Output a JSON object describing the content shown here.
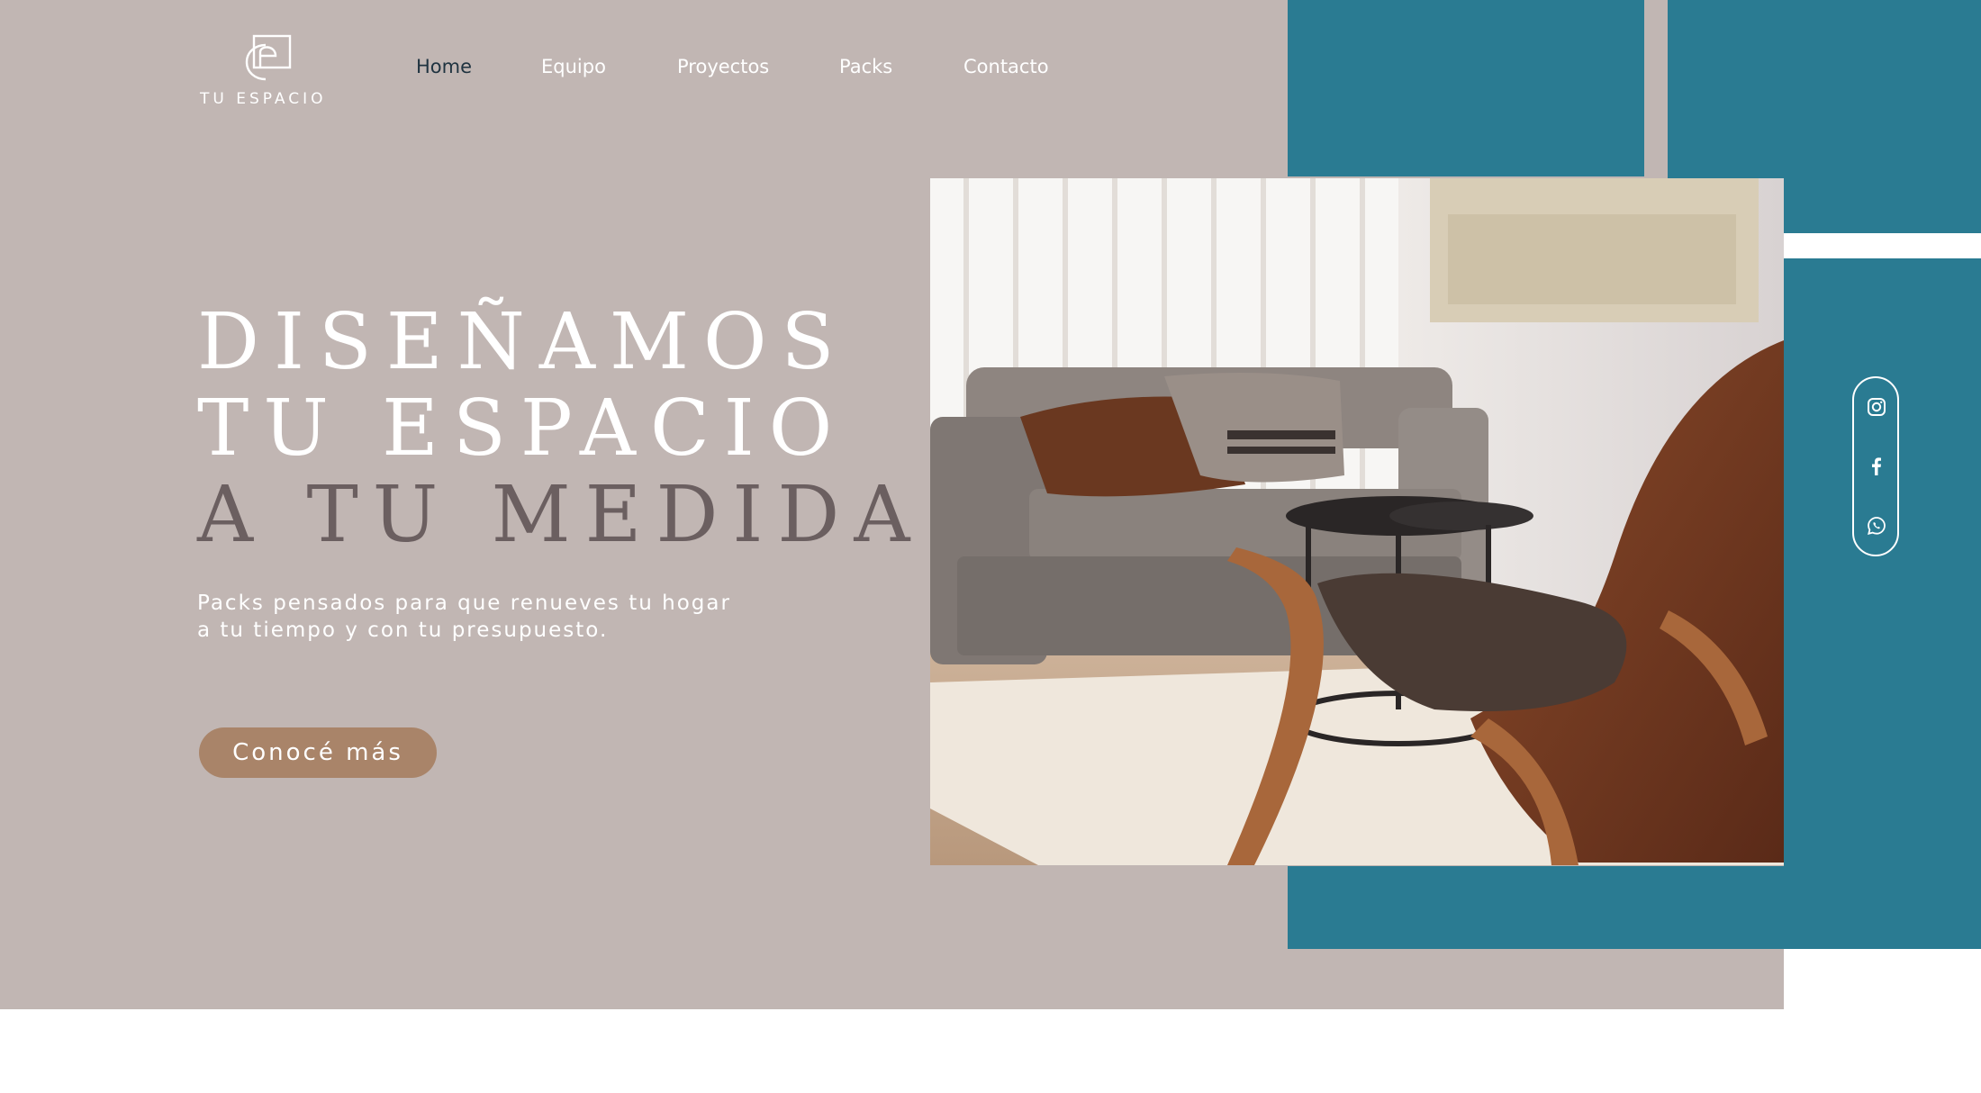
{
  "brand": {
    "name": "TU ESPACIO",
    "logo_icon": "logo-mark-icon"
  },
  "nav": {
    "items": [
      {
        "label": "Home",
        "active": true
      },
      {
        "label": "Equipo"
      },
      {
        "label": "Proyectos"
      },
      {
        "label": "Packs"
      },
      {
        "label": "Contacto"
      }
    ]
  },
  "hero": {
    "headline": [
      "DISEÑAMOS",
      "TU ESPACIO",
      "A TU MEDIDA"
    ],
    "subtitle": [
      "Packs pensados para que renueves tu hogar",
      "a tu tiempo y con tu presupuesto."
    ],
    "cta_label": "Conocé más"
  },
  "social": [
    "instagram-icon",
    "facebook-icon",
    "whatsapp-icon"
  ],
  "colors": {
    "hero_background": "#c1b6b3",
    "teal": "#2a7b92",
    "button": "#a98469",
    "headline_dark": "#6b5f60",
    "nav_active": "#1f3340"
  }
}
